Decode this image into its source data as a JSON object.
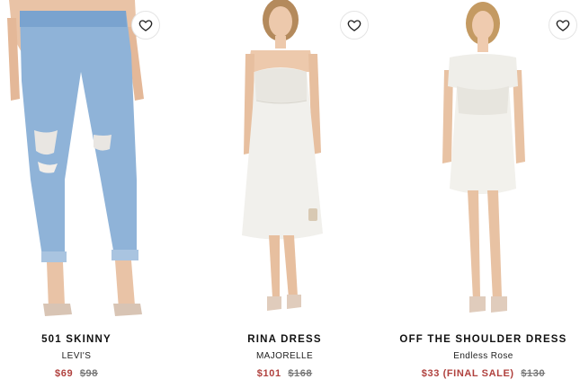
{
  "products": [
    {
      "name": "501 SKINNY",
      "brand": "LEVI'S",
      "sale_price": "$69",
      "original_price": "$98",
      "image_icon": "model-jeans-image"
    },
    {
      "name": "RINA DRESS",
      "brand": "MAJORELLE",
      "sale_price": "$101",
      "original_price": "$168",
      "image_icon": "model-white-dress-image"
    },
    {
      "name": "OFF THE SHOULDER DRESS",
      "brand": "Endless Rose",
      "sale_price": "$33 (FINAL SALE)",
      "original_price": "$130",
      "image_icon": "model-off-shoulder-dress-image"
    }
  ],
  "wishlist_icon": "heart-icon",
  "colors": {
    "sale": "#b0413e",
    "original": "#777777",
    "text": "#111111"
  }
}
